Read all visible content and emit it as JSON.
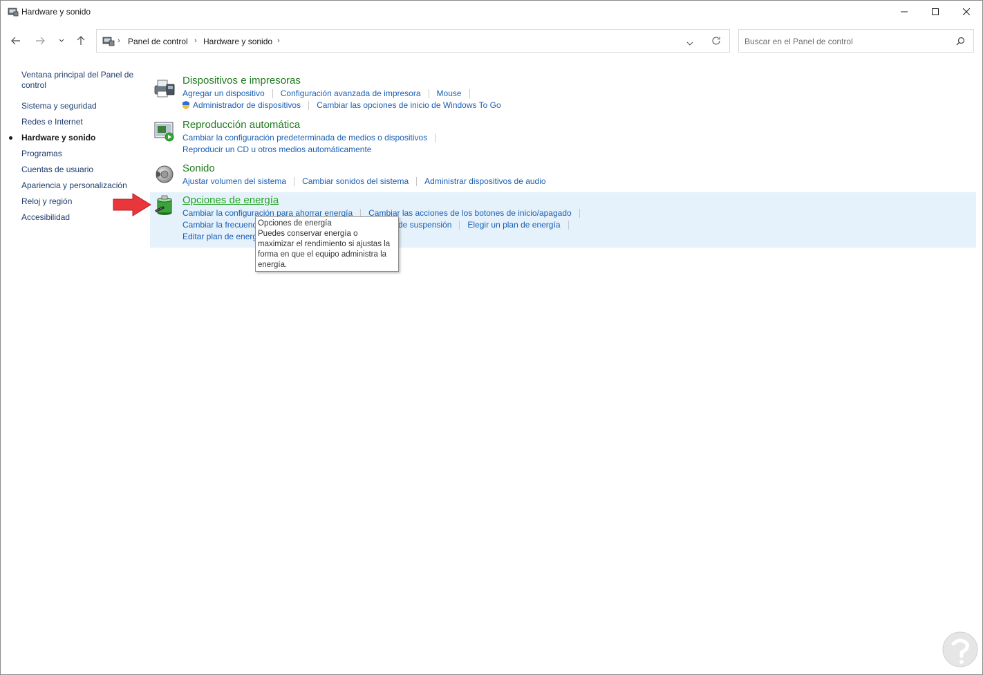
{
  "window": {
    "title": "Hardware y sonido",
    "controls": {
      "minimize": "minimize-icon",
      "maximize": "maximize-icon",
      "close": "close-icon"
    }
  },
  "nav": {
    "breadcrumb": [
      "Panel de control",
      "Hardware y sonido"
    ],
    "search_placeholder": "Buscar en el Panel de control"
  },
  "sidebar": {
    "items": [
      {
        "label": "Ventana principal del Panel de",
        "label2": "control",
        "active": false
      },
      {
        "label": "Sistema y seguridad",
        "active": false
      },
      {
        "label": "Redes e Internet",
        "active": false
      },
      {
        "label": "Hardware y sonido",
        "active": true
      },
      {
        "label": "Programas",
        "active": false
      },
      {
        "label": "Cuentas de usuario",
        "active": false
      },
      {
        "label": "Apariencia y personalización",
        "active": false
      },
      {
        "label": "Reloj y región",
        "active": false
      },
      {
        "label": "Accesibilidad",
        "active": false
      }
    ]
  },
  "categories": [
    {
      "title": "Dispositivos e impresoras",
      "icon": "printer-icon",
      "rows": [
        [
          "Agregar un dispositivo",
          "Configuración avanzada de impresora",
          "Mouse"
        ],
        [
          "Administrador de dispositivos",
          "Cambiar las opciones de inicio de Windows To Go"
        ]
      ]
    },
    {
      "title": "Reproducción automática",
      "icon": "autoplay-icon",
      "rows": [
        [
          "Cambiar la configuración predeterminada de medios o dispositivos"
        ],
        [
          "Reproducir un CD u otros medios automáticamente"
        ]
      ]
    },
    {
      "title": "Sonido",
      "icon": "speaker-icon",
      "rows": [
        [
          "Ajustar volumen del sistema",
          "Cambiar sonidos del sistema",
          "Administrar dispositivos de audio"
        ]
      ]
    },
    {
      "title": "Opciones de energía",
      "icon": "battery-icon",
      "rows": [
        [
          "Cambiar la configuración para ahorrar energía",
          "Cambiar las acciones de los botones de inicio/apagado"
        ],
        [
          "Cambiar la frecuencia",
          "de suspensión",
          "Elegir un plan de energía"
        ],
        [
          "Editar plan de energ"
        ]
      ]
    }
  ],
  "tooltip": {
    "title": "Opciones de energía",
    "lines": [
      "Puedes conservar energía o",
      "maximizar el rendimiento si ajustas la",
      "forma en que el equipo administra la",
      "energía."
    ]
  },
  "colors": {
    "category_title": "#1e7a1e",
    "link": "#1a5fb4",
    "highlight_bg": "#e5f1fb",
    "arrow": "#e8363a"
  }
}
